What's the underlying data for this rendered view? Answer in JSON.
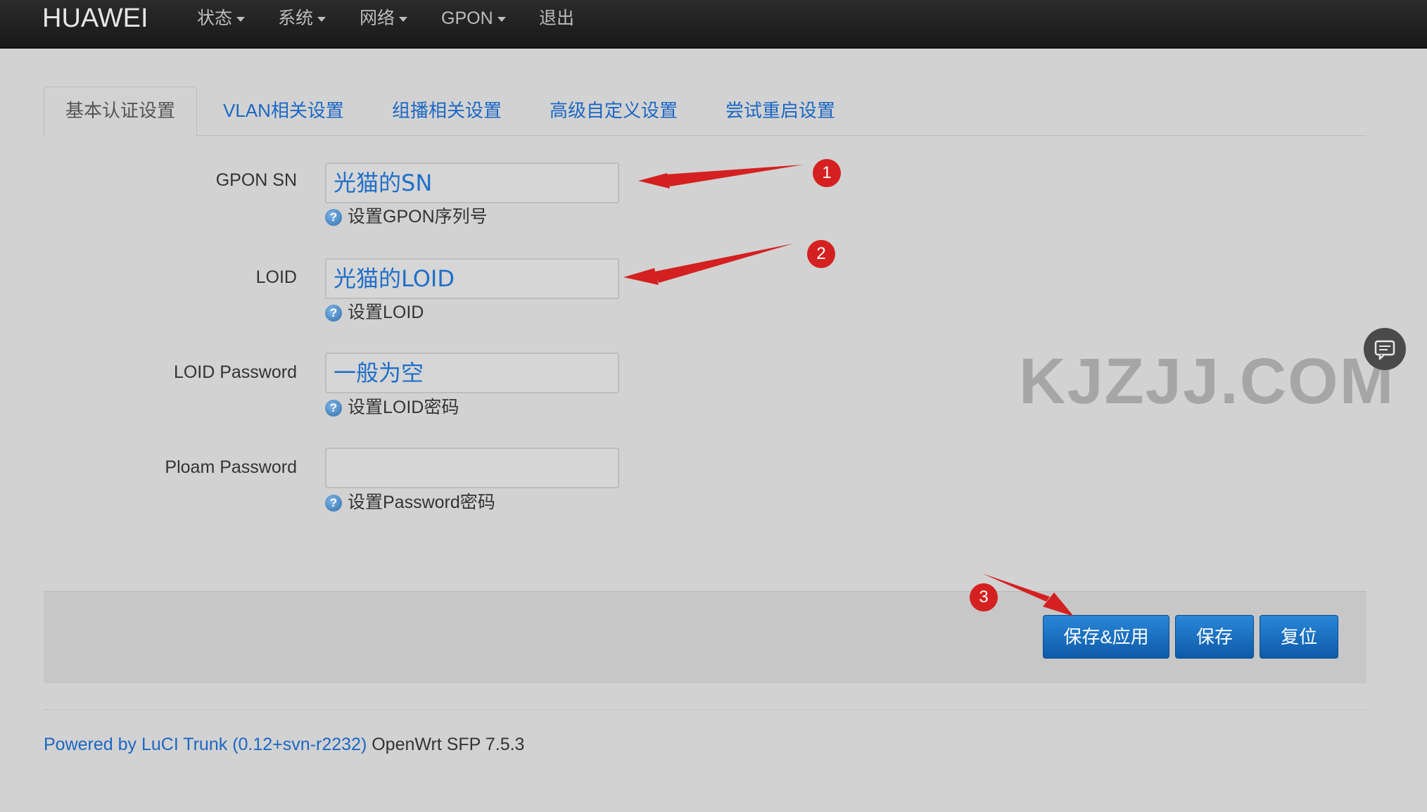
{
  "navbar": {
    "brand": "HUAWEI",
    "menu": [
      {
        "label": "状态",
        "dropdown": true
      },
      {
        "label": "系统",
        "dropdown": true
      },
      {
        "label": "网络",
        "dropdown": true
      },
      {
        "label": "GPON",
        "dropdown": true
      },
      {
        "label": "退出",
        "dropdown": false
      }
    ]
  },
  "tabs": [
    {
      "label": "基本认证设置",
      "active": true
    },
    {
      "label": "VLAN相关设置",
      "active": false
    },
    {
      "label": "组播相关设置",
      "active": false
    },
    {
      "label": "高级自定义设置",
      "active": false
    },
    {
      "label": "尝试重启设置",
      "active": false
    }
  ],
  "form": {
    "gpon_sn": {
      "label": "GPON SN",
      "value": "光猫的SN",
      "help": "设置GPON序列号"
    },
    "loid": {
      "label": "LOID",
      "value": "光猫的LOID",
      "help": "设置LOID"
    },
    "loid_password": {
      "label": "LOID Password",
      "value": "一般为空",
      "help": "设置LOID密码"
    },
    "ploam_password": {
      "label": "Ploam Password",
      "value": "",
      "help": "设置Password密码"
    }
  },
  "help_icon_glyph": "?",
  "actions": {
    "save_apply": "保存&应用",
    "save": "保存",
    "reset": "复位"
  },
  "annotations": [
    "1",
    "2",
    "3"
  ],
  "footer": {
    "link": "Powered by LuCI Trunk (0.12+svn-r2232)",
    "version": "OpenWrt SFP 7.5.3"
  },
  "watermark": "KJZJJ.COM",
  "colors": {
    "navbar": "#1f1f1f",
    "link": "#1b67c4",
    "button": "#1169c0",
    "annotation": "#d42020"
  }
}
